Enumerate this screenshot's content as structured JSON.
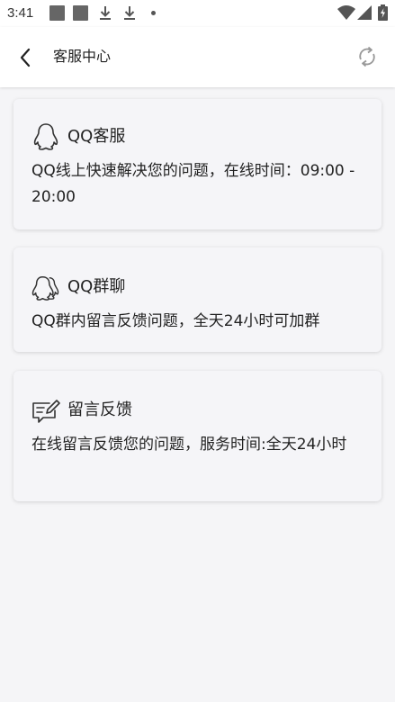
{
  "status_bar": {
    "time": "3:41",
    "icons": [
      "notification-square-icon",
      "notification-square-icon",
      "download-icon",
      "download-icon",
      "dot-icon",
      "wifi-icon",
      "signal-icon",
      "battery-charging-icon"
    ]
  },
  "header": {
    "title": "客服中心",
    "back_icon": "chevron-left-icon",
    "refresh_icon": "refresh-icon"
  },
  "cards": [
    {
      "icon": "qq-penguin-icon",
      "title": "QQ客服",
      "description": "QQ线上快速解决您的问题，在线时间：09:00 - 20:00"
    },
    {
      "icon": "qq-group-icon",
      "title": "QQ群聊",
      "description": "QQ群内留言反馈问题，全天24小时可加群"
    },
    {
      "icon": "message-edit-icon",
      "title": "留言反馈",
      "description": "在线留言反馈您的问题，服务时间:全天24小时"
    }
  ],
  "colors": {
    "background": "#f5f5f7",
    "card": "#f5f5f8",
    "header": "#ffffff",
    "text": "#222222",
    "icon": "#333333"
  }
}
